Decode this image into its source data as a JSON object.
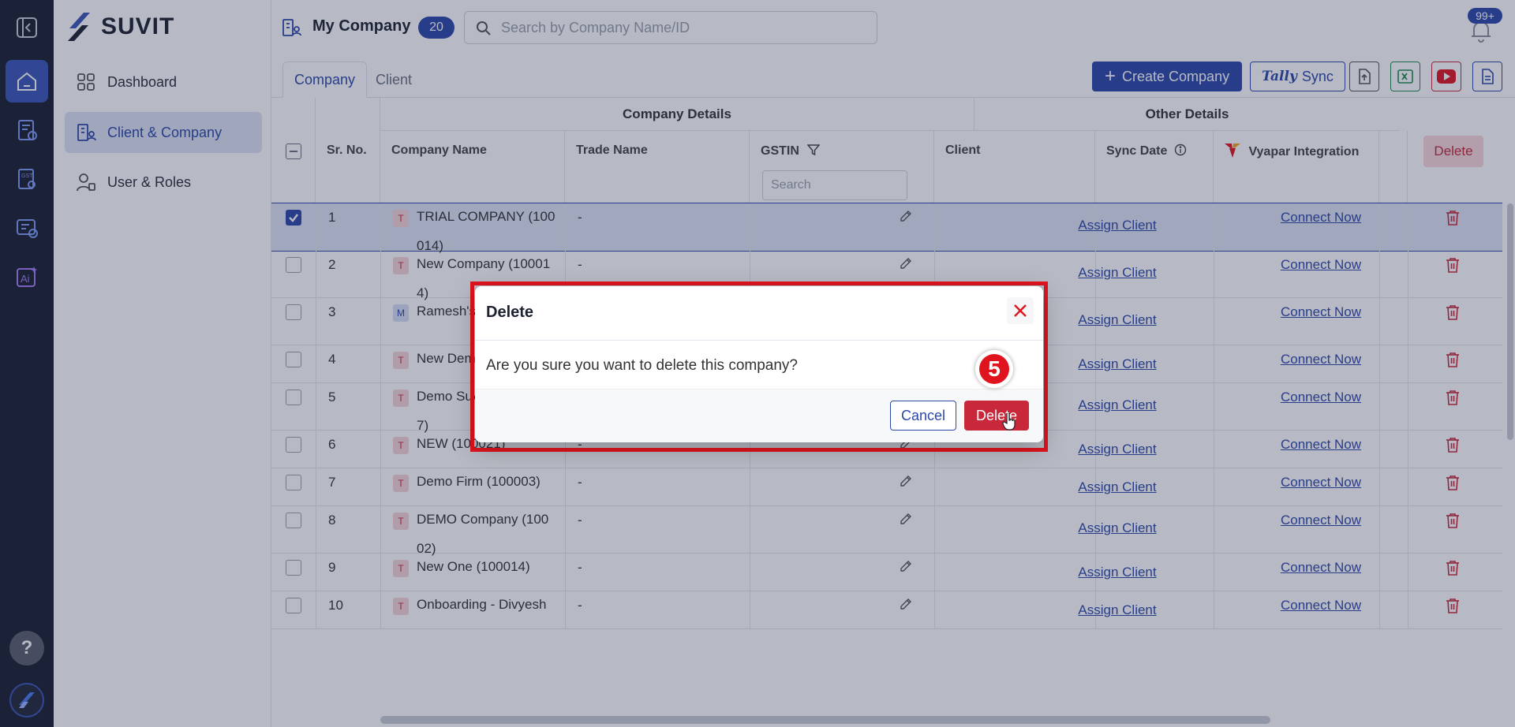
{
  "brand": {
    "name": "SUVIT"
  },
  "sidebar": {
    "items": [
      {
        "label": "Dashboard"
      },
      {
        "label": "Client & Company"
      },
      {
        "label": "User & Roles"
      }
    ]
  },
  "header": {
    "title": "My Company",
    "count": "20",
    "search_placeholder": "Search by Company Name/ID",
    "notification_count": "99+"
  },
  "tabs": [
    {
      "label": "Company"
    },
    {
      "label": "Client"
    }
  ],
  "toolbar": {
    "create_label": "Create Company",
    "tally_label": "Tally",
    "sync_label": "Sync"
  },
  "table": {
    "groups": {
      "company_details": "Company Details",
      "other_details": "Other Details"
    },
    "columns": {
      "sr": "Sr. No.",
      "company": "Company Name",
      "trade": "Trade Name",
      "gstin": "GSTIN",
      "client": "Client",
      "sync": "Sync Date",
      "vyapar": "Vyapar Integration",
      "delete": "Delete"
    },
    "gstin_search_placeholder": "Search",
    "rows": [
      {
        "sr": "1",
        "badge": "T",
        "name": "TRIAL COMPANY (100014)",
        "trade": "-",
        "client": "Assign Client",
        "vyapar": "Connect Now",
        "checked": true
      },
      {
        "sr": "2",
        "badge": "T",
        "name": "New Company (100014)",
        "trade": "-",
        "client": "Assign Client",
        "vyapar": "Connect Now",
        "checked": false
      },
      {
        "sr": "3",
        "badge": "M",
        "name": "Ramesh's (S_10009)",
        "trade": "",
        "client": "Assign Client",
        "vyapar": "Connect Now",
        "checked": false
      },
      {
        "sr": "4",
        "badge": "T",
        "name": "New Dem",
        "trade": "",
        "client": "Assign Client",
        "vyapar": "Connect Now",
        "checked": false
      },
      {
        "sr": "5",
        "badge": "T",
        "name": "Demo Suvit_1 (100007)",
        "trade": "",
        "client": "Assign Client",
        "vyapar": "Connect Now",
        "checked": false
      },
      {
        "sr": "6",
        "badge": "T",
        "name": "NEW (100021)",
        "trade": "-",
        "client": "Assign Client",
        "vyapar": "Connect Now",
        "checked": false
      },
      {
        "sr": "7",
        "badge": "T",
        "name": "Demo Firm (100003)",
        "trade": "-",
        "client": "Assign Client",
        "vyapar": "Connect Now",
        "checked": false
      },
      {
        "sr": "8",
        "badge": "T",
        "name": "DEMO Company (10002)",
        "trade": "-",
        "client": "Assign Client",
        "vyapar": "Connect Now",
        "checked": false
      },
      {
        "sr": "9",
        "badge": "T",
        "name": "New One (100014)",
        "trade": "-",
        "client": "Assign Client",
        "vyapar": "Connect Now",
        "checked": false
      },
      {
        "sr": "10",
        "badge": "T",
        "name": "Onboarding - Divyesh",
        "trade": "-",
        "client": "Assign Client",
        "vyapar": "Connect Now",
        "checked": false
      }
    ]
  },
  "modal": {
    "title": "Delete",
    "message": "Are you sure you want to delete this company?",
    "cancel_label": "Cancel",
    "confirm_label": "Delete"
  },
  "annotation": {
    "step": "5"
  },
  "colors": {
    "primary": "#2c48a8",
    "danger": "#c8283a",
    "highlight": "#e0141e",
    "rail": "#1a1e2e"
  }
}
